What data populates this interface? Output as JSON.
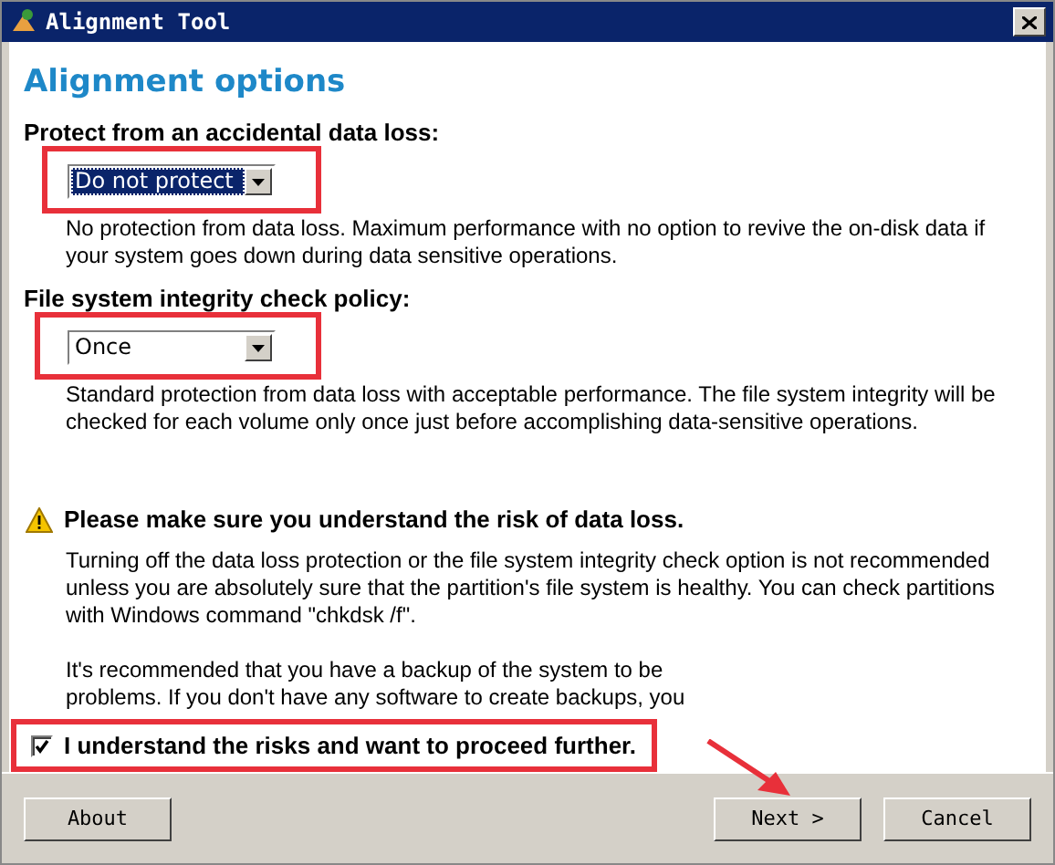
{
  "window": {
    "title": "Alignment Tool"
  },
  "heading": "Alignment options",
  "options": [
    {
      "label": "Protect from an accidental data loss:",
      "value": "Do not protect",
      "focused": true,
      "description": "No protection from data loss. Maximum performance with no option to revive the on-disk data if your system goes down during data sensitive operations."
    },
    {
      "label": "File system integrity check policy:",
      "value": "Once",
      "focused": false,
      "description": "Standard protection from data loss with acceptable performance. The file system integrity will be checked for each volume only once just before accomplishing data-sensitive operations."
    }
  ],
  "warning": {
    "title": "Please make sure you understand the risk of data loss.",
    "paragraphs": [
      "Turning off the data loss protection or the file system integrity check option is not recommended unless you are absolutely sure that the partition's file system is healthy. You can check partitions with Windows command \"chkdsk /f\".",
      "It's recommended that you have a backup of the system to be\nproblems. If you don't have any software to create backups, you"
    ]
  },
  "confirm": {
    "label": "I understand the risks and want to proceed further.",
    "checked": true
  },
  "buttons": [
    {
      "label": "About",
      "kind": "left"
    },
    {
      "label": "Next >",
      "kind": "right"
    },
    {
      "label": "Cancel",
      "kind": "right"
    }
  ]
}
